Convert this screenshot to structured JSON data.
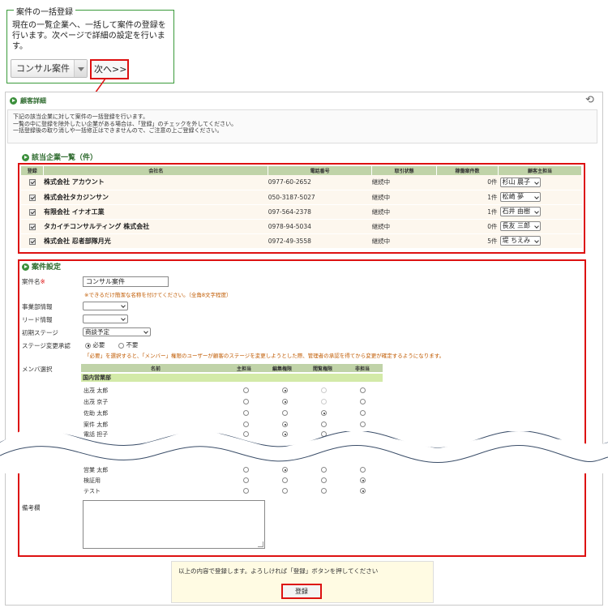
{
  "bulk": {
    "legend": "案件の一括登録",
    "desc": "現在の一覧企業へ、一括して案件の登録を行います。次ページで詳細の設定を行います。",
    "type_value": "コンサル案件",
    "next_label": "次へ>>"
  },
  "detail": {
    "title": "顧客詳細",
    "info_lines": [
      "下記の該当企業に対して案件の一括登録を行います。",
      "一覧の中に登録を除外したい企業がある場合は、「登録」のチェックを外してください。",
      "一括登録後の取り消しや一括修正はできませんので、ご注意の上ご登録ください。"
    ]
  },
  "companies": {
    "title": "該当企業一覧（件）",
    "headers": [
      "登録",
      "会社名",
      "電話番号",
      "取引状態",
      "稼働案件数",
      "顧客主担当"
    ],
    "rows": [
      {
        "name": "株式会社 アカウント",
        "phone": "0977-60-2652",
        "status": "継続中",
        "count": "0件",
        "owner": "杉山 晨子"
      },
      {
        "name": "株式会社タカジンサン",
        "phone": "050-3187-5027",
        "status": "継続中",
        "count": "1件",
        "owner": "松崎 夢"
      },
      {
        "name": "有限会社 イナオ工業",
        "phone": "097-564-2378",
        "status": "継続中",
        "count": "1件",
        "owner": "石井 由樹"
      },
      {
        "name": "タカイチコンサルティング 株式会社",
        "phone": "0978-94-5034",
        "status": "継続中",
        "count": "0件",
        "owner": "長友 三郎"
      },
      {
        "name": "株式会社 忍者部隊月光",
        "phone": "0972-49-3558",
        "status": "継続中",
        "count": "5件",
        "owner": "堤 ちえみ"
      }
    ]
  },
  "settings": {
    "title": "案件設定",
    "case_name_label": "案件名",
    "required_mark": "※",
    "case_name_value": "コンサル案件",
    "case_name_hint": "※できるだけ簡潔な名称を付けてください。（全角8文字程度）",
    "dept_label": "事業部情報",
    "lead_label": "リード情報",
    "stage_label": "初期ステージ",
    "stage_value": "商談予定",
    "approval_label": "ステージ変更承認",
    "approval_opt1": "必要",
    "approval_opt2": "不要",
    "approval_hint": "「必要」を選択すると、「メンバー」権限のユーザーが顧客のステージを変更しようとした際、管理者の承認を得てから変更が確定するようになります。",
    "member_label": "メンバ選択",
    "member_headers": [
      "名前",
      "主担当",
      "編集権限",
      "閲覧権限",
      "非担当"
    ],
    "group_name": "国内営業部",
    "members_top": [
      {
        "name": "出茂 太郎",
        "sel": 1
      },
      {
        "name": "出茂 京子",
        "sel": 1
      },
      {
        "name": "佐助 太郎",
        "sel": 2
      },
      {
        "name": "案件 太郎",
        "sel": 1
      },
      {
        "name": "電話 担子",
        "sel": 1
      }
    ],
    "members_bottom": [
      {
        "name": "営業 太郎",
        "sel": 1
      },
      {
        "name": "検証用",
        "sel": 3
      },
      {
        "name": "テスト",
        "sel": 3
      }
    ],
    "notes_label": "備考欄"
  },
  "confirm": {
    "text": "以上の内容で登録します。よろしければ「登録」ボタンを押してください",
    "register_label": "登録"
  }
}
